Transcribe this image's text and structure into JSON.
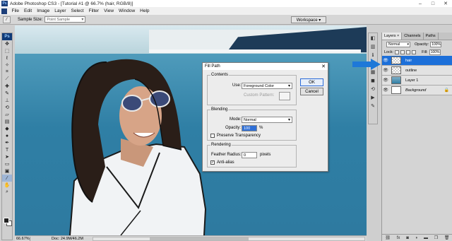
{
  "window": {
    "title": "Adobe Photoshop CS3 - [Tutorial #1 @ 66.7% (hair, RGB/8)]",
    "app_icon": "Ps"
  },
  "menu": [
    "File",
    "Edit",
    "Image",
    "Layer",
    "Select",
    "Filter",
    "View",
    "Window",
    "Help"
  ],
  "options_bar": {
    "sample_size_label": "Sample Size:",
    "sample_size_value": "Point Sample",
    "workspace_label": "Workspace ▾"
  },
  "status": {
    "zoom": "66.67%",
    "doc": "Doc: 24.9M/46.2M"
  },
  "layers_panel": {
    "tabs": [
      "Layers ×",
      "Channels",
      "Paths"
    ],
    "blend_mode": "Normal",
    "opacity_label": "Opacity:",
    "opacity_value": "100%",
    "lock_label": "Lock:",
    "fill_label": "Fill:",
    "fill_value": "100%",
    "layers": [
      {
        "name": "hair",
        "active": true
      },
      {
        "name": "outline",
        "active": false
      },
      {
        "name": "Layer 1",
        "active": false
      },
      {
        "name": "Background",
        "active": false,
        "locked": true
      }
    ]
  },
  "dialog": {
    "title": "Fill Path",
    "contents_legend": "Contents",
    "use_label": "Use:",
    "use_value": "Foreground Color",
    "custom_pattern_label": "Custom Pattern:",
    "blending_legend": "Blending",
    "mode_label": "Mode:",
    "mode_value": "Normal",
    "opacity_label": "Opacity:",
    "opacity_value": "100",
    "opacity_unit": "%",
    "preserve_label": "Preserve Transparency",
    "rendering_legend": "Rendering",
    "feather_label": "Feather Radius:",
    "feather_value": "0",
    "feather_unit": "pixels",
    "antialias_label": "Anti-alias",
    "ok_label": "OK",
    "cancel_label": "Cancel"
  },
  "colors": {
    "accent": "#1c6fd9",
    "arrow": "#1e78d8",
    "foreground_swatch": "#222222"
  }
}
